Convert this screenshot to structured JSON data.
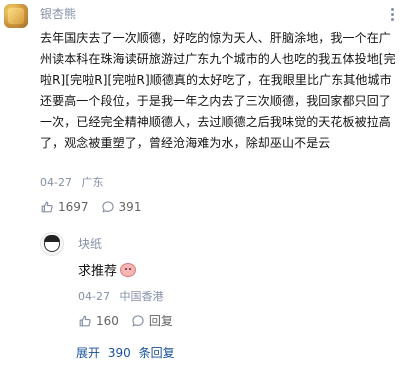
{
  "comment": {
    "author": "银杏熊",
    "text": "去年国庆去了一次顺德，好吃的惊为天人、肝脑涂地，我一个在广州读本科在珠海读研旅游过广东九个城市的人也吃的我五体投地[完啦R][完啦R][完啦R]顺德真的太好吃了，在我眼里比广东其他城市还要高一个段位，于是我一年之内去了三次顺德，我回家都只回了一次，已经完全精神顺德人，去过顺德之后我味觉的天花板被拉高了，观念被重塑了，曾经沧海难为水，除却巫山不是云",
    "date": "04-27",
    "location": "广东",
    "like_count": "1697",
    "reply_count": "391"
  },
  "reply": {
    "author": "块纸",
    "text": "求推荐",
    "date": "04-27",
    "location": "中国香港",
    "like_count": "160",
    "reply_label": "回复"
  },
  "expand": {
    "prefix": "展开",
    "count": "390",
    "suffix": "条回复"
  },
  "icons": {
    "like": "thumbs-up-icon",
    "comment": "comment-bubble-icon",
    "more": "more-vertical-icon"
  },
  "colors": {
    "meta_gray": "#8590a6",
    "link_blue": "#175199",
    "text": "#121212"
  }
}
